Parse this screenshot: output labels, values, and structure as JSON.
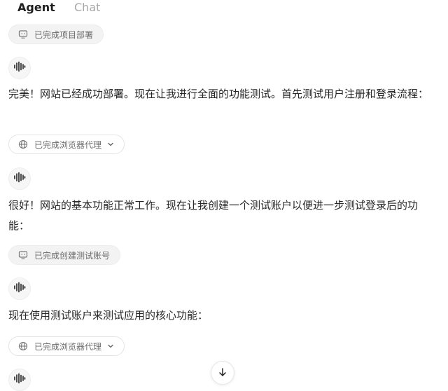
{
  "tabs": {
    "agent": "Agent",
    "chat": "Chat"
  },
  "items": {
    "pill1": {
      "label": "已完成项目部署",
      "icon": "monitor-icon"
    },
    "msg1": "完美！网站已经成功部署。现在让我进行全面的功能测试。首先测试用户注册和登录流程：",
    "pill2": {
      "label": "已完成浏览器代理",
      "icon": "globe-icon"
    },
    "msg2": "很好！网站的基本功能正常工作。现在让我创建一个测试账户以便进一步测试登录后的功能：",
    "pill3": {
      "label": "已完成创建测试账号",
      "icon": "monitor-icon"
    },
    "msg3": "现在使用测试账户来测试应用的核心功能：",
    "pill4": {
      "label": "已完成浏览器代理",
      "icon": "globe-icon"
    }
  },
  "colors": {
    "pill_bg": "#f3f3f3",
    "text": "#262626",
    "muted": "#6b6b6b"
  }
}
